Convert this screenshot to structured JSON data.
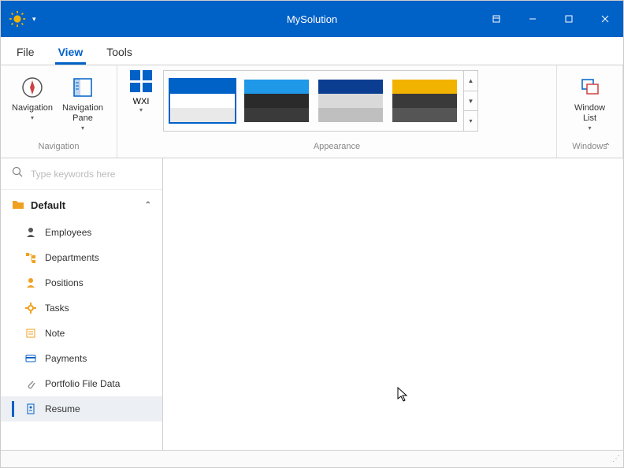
{
  "title": "MySolution",
  "menu": {
    "file": "File",
    "view": "View",
    "tools": "Tools",
    "active": "view"
  },
  "ribbon": {
    "navigation_group": "Navigation",
    "appearance_group": "Appearance",
    "windows_group": "Windows",
    "navigation_btn": "Navigation",
    "navpane_btn": "Navigation\nPane",
    "wxi_btn": "WXI",
    "windowlist_btn": "Window\nList",
    "swatches": [
      {
        "c1": "#0061c7",
        "c2": "#ffffff",
        "c3": "#e9e9e9",
        "selected": true
      },
      {
        "c1": "#1f98e8",
        "c2": "#2a2a2a",
        "c3": "#3a3a3a",
        "selected": false
      },
      {
        "c1": "#0b3e91",
        "c2": "#d9d9d9",
        "c3": "#bfbfbf",
        "selected": false
      },
      {
        "c1": "#f2b200",
        "c2": "#3a3a3a",
        "c3": "#555555",
        "selected": false
      }
    ]
  },
  "search": {
    "placeholder": "Type keywords here"
  },
  "sidebar": {
    "group": "Default",
    "items": [
      {
        "label": "Employees",
        "icon": "person",
        "color": "#555"
      },
      {
        "label": "Departments",
        "icon": "tree",
        "color": "#f0a020"
      },
      {
        "label": "Positions",
        "icon": "person",
        "color": "#f0a020"
      },
      {
        "label": "Tasks",
        "icon": "gear",
        "color": "#f0a020"
      },
      {
        "label": "Note",
        "icon": "note",
        "color": "#f0a020"
      },
      {
        "label": "Payments",
        "icon": "card",
        "color": "#0061c7"
      },
      {
        "label": "Portfolio File Data",
        "icon": "clip",
        "color": "#888"
      },
      {
        "label": "Resume",
        "icon": "doc",
        "color": "#0061c7"
      }
    ],
    "selected": 7
  }
}
